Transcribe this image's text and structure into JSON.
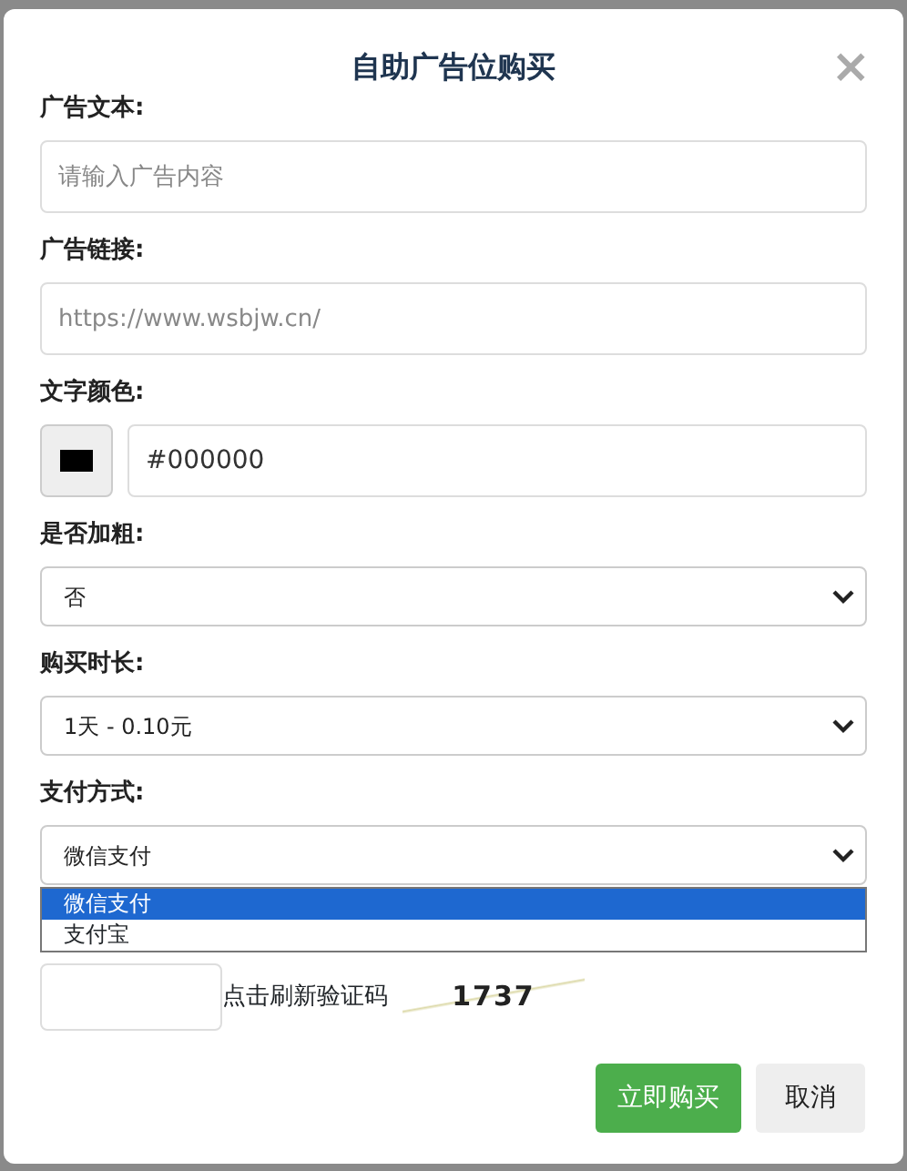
{
  "dialog": {
    "title": "自助广告位购买",
    "close": "×"
  },
  "fields": [
    {
      "kind": "text",
      "label": "广告文本:",
      "placeholder": "请输入广告内容"
    },
    {
      "kind": "text",
      "label": "广告链接:",
      "placeholder": "https://www.wsbjw.cn/"
    },
    {
      "kind": "color",
      "label": "文字颜色:",
      "value": "#000000",
      "color": "#000000"
    },
    {
      "kind": "select",
      "label": "是否加粗:",
      "value": "否"
    },
    {
      "kind": "select",
      "label": "购买时长:",
      "value": "1天 - 0.10元"
    },
    {
      "kind": "select",
      "label": "支付方式:",
      "value": "微信支付",
      "expanded": true,
      "options": [
        {
          "label": "微信支付",
          "selected": true
        },
        {
          "label": "支付宝",
          "selected": false
        }
      ]
    }
  ],
  "captcha": {
    "hint": "点击刷新验证码",
    "code": "1737"
  },
  "buttons": [
    {
      "kind": "primary",
      "label": "立即购买"
    },
    {
      "kind": "secondary",
      "label": "取消"
    }
  ]
}
